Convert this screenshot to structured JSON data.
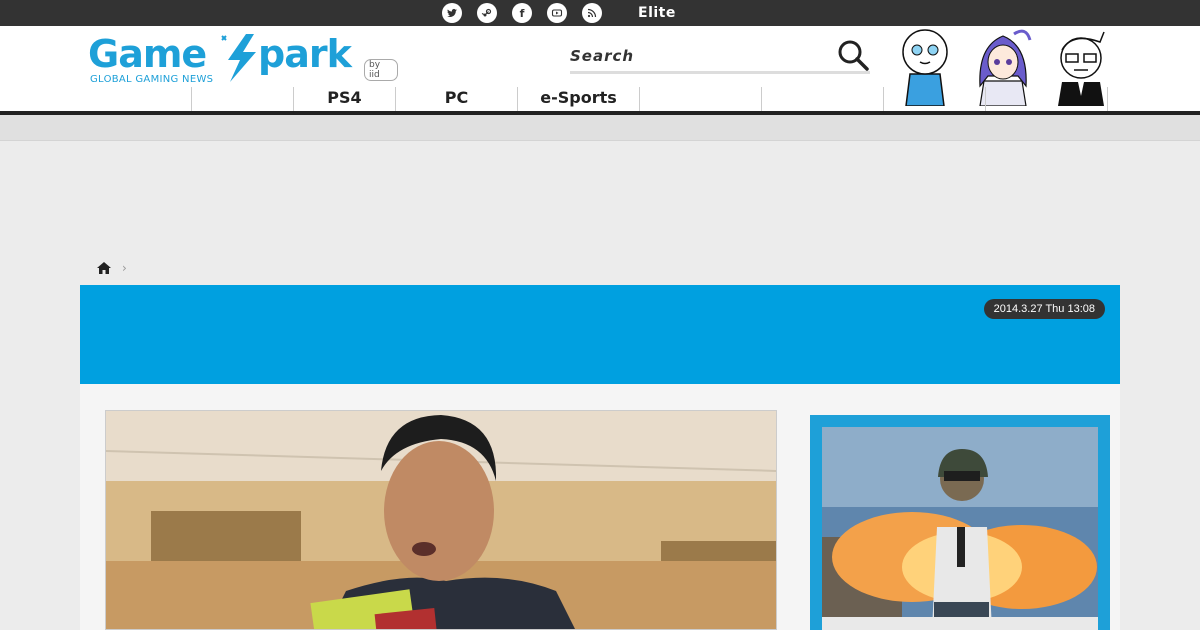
{
  "topbar": {
    "site_label": "",
    "social_icons": [
      "twitter-icon",
      "steam-icon",
      "facebook-icon",
      "youtube-icon",
      "rss-icon"
    ],
    "facebook_glyph": "f",
    "lock_glyph": "",
    "elite_label": "Elite",
    "elite_glyph": ""
  },
  "header": {
    "logo": {
      "word_left": "Game",
      "word_right": "park",
      "tagline": "GLOBAL GAMING NEWS",
      "byline": "by iid"
    },
    "search": {
      "placeholder": "Search"
    },
    "nav": [
      "",
      "",
      "PS4",
      "PC",
      "e-Sports",
      "",
      "",
      "",
      ""
    ]
  },
  "breadcrumb": {
    "separator": "›"
  },
  "article": {
    "date": "2014.3.27 Thu 13:08"
  },
  "colors": {
    "accent": "#1ea0d8",
    "banner": "#00a0e0",
    "topbar": "#333333",
    "date_badge": "#333333"
  }
}
